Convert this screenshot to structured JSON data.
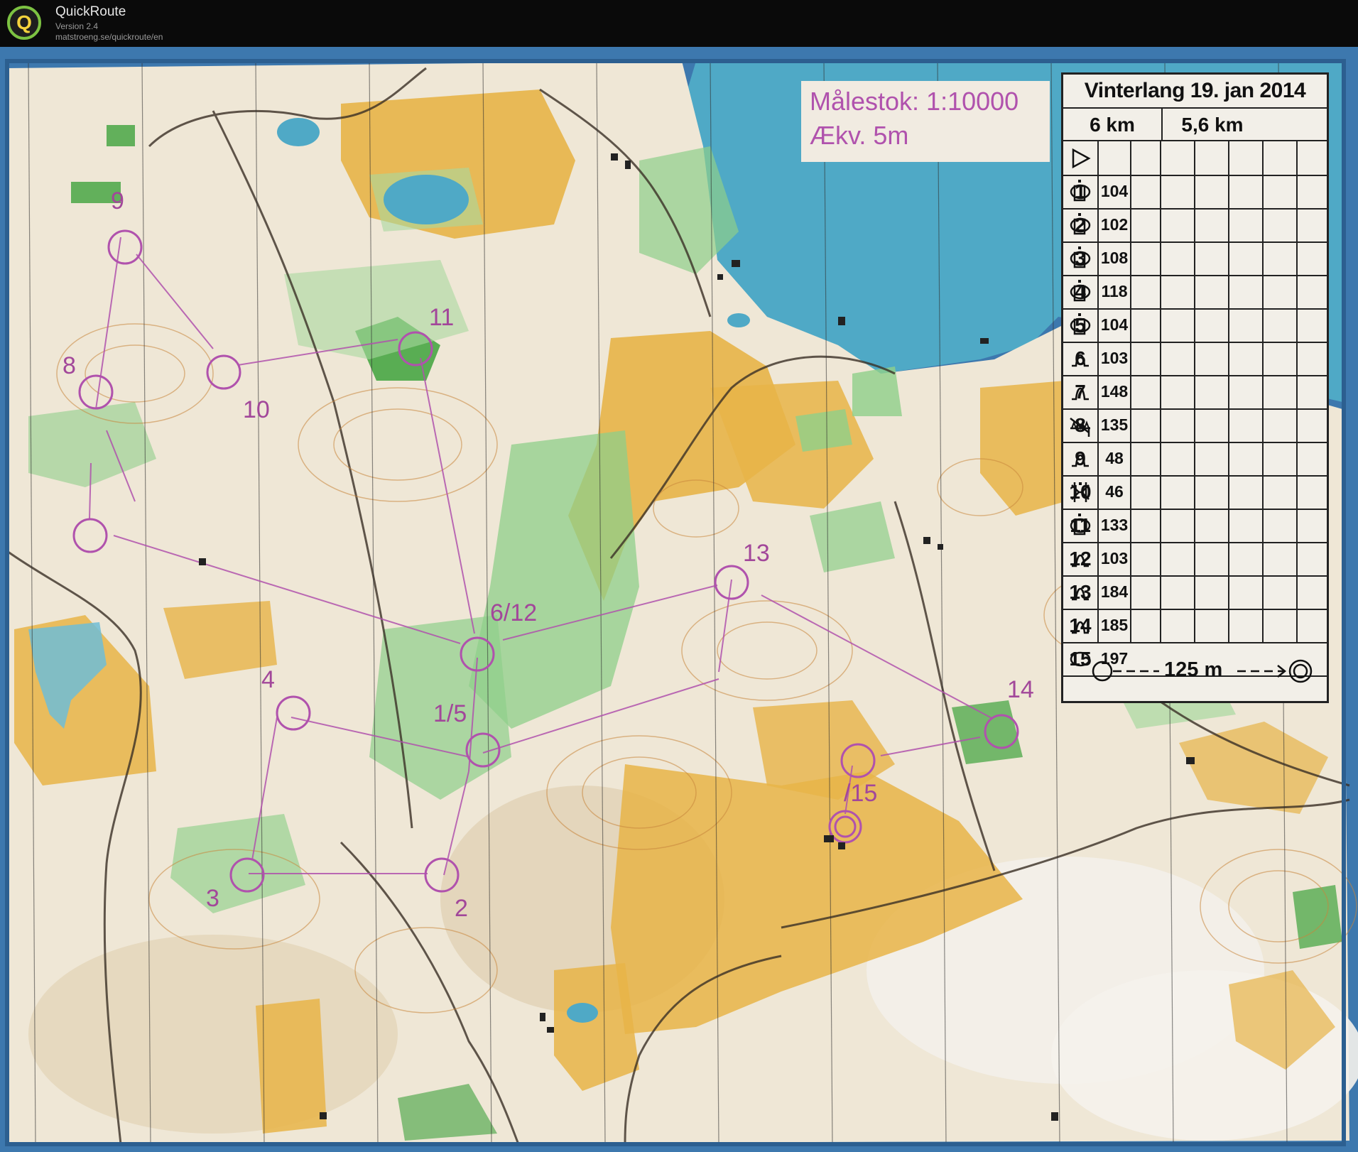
{
  "app": {
    "name": "QuickRoute",
    "version": "Version 2.4",
    "url": "matstroeng.se/quickroute/en",
    "logo_letter": "Q"
  },
  "map": {
    "scale": "Målestok: 1:10000",
    "contour": "Ækv. 5m",
    "colors": {
      "paper": "#efe7d6",
      "open_land": "#e7b448",
      "green": "#8fcf8a",
      "dark_green": "#3ea23c",
      "water": "#5fb4cf",
      "course": "#b052ad",
      "contour": "#c8863c"
    },
    "controls": [
      "9",
      "8",
      "10",
      "11",
      "6/12",
      "13",
      "4",
      "1/5",
      "14",
      "/15",
      "3",
      "2"
    ]
  },
  "control_descriptions": {
    "title": "Vinterlang 19. jan 2014",
    "lengths": [
      "6 km",
      "5,6 km"
    ],
    "start_icon": "start-triangle-icon",
    "rows": [
      {
        "no": "1",
        "code": "104",
        "feature": "knoll-oval-icon",
        "extra": "top-of-feature-icon"
      },
      {
        "no": "2",
        "code": "102",
        "feature": "knoll-oval-icon",
        "extra": "top-of-feature-icon"
      },
      {
        "no": "3",
        "code": "108",
        "feature": "knoll-oval-icon",
        "extra": "top-of-feature-icon"
      },
      {
        "no": "4",
        "code": "118",
        "feature": "knoll-oval-icon",
        "extra": "top-of-feature-icon"
      },
      {
        "no": "5",
        "code": "104",
        "feature": "knoll-oval-icon",
        "extra": "top-of-feature-icon"
      },
      {
        "no": "6",
        "code": "103",
        "feature": "hill-icon",
        "extra": ""
      },
      {
        "no": "7",
        "code": "148",
        "feature": "hill-icon",
        "extra": ""
      },
      {
        "no": "8",
        "code": "135",
        "feature": "cliff-icon",
        "extra": "foot-of-feature-icon"
      },
      {
        "no": "9",
        "code": "48",
        "feature": "hill-icon",
        "extra": ""
      },
      {
        "no": "10",
        "code": "46",
        "feature": "re-entrant-icon",
        "extra": "between-icon"
      },
      {
        "no": "11",
        "code": "133",
        "feature": "knoll-oval-icon",
        "extra": "top-of-feature-icon"
      },
      {
        "no": "12",
        "code": "103",
        "feature": "hill-icon",
        "extra": ""
      },
      {
        "no": "13",
        "code": "184",
        "feature": "hill-icon",
        "extra": ""
      },
      {
        "no": "14",
        "code": "185",
        "feature": "hill-icon",
        "extra": ""
      },
      {
        "no": "15",
        "code": "197",
        "feature": "knoll-oval-icon",
        "extra": ""
      }
    ],
    "finish_distance": "125 m"
  }
}
